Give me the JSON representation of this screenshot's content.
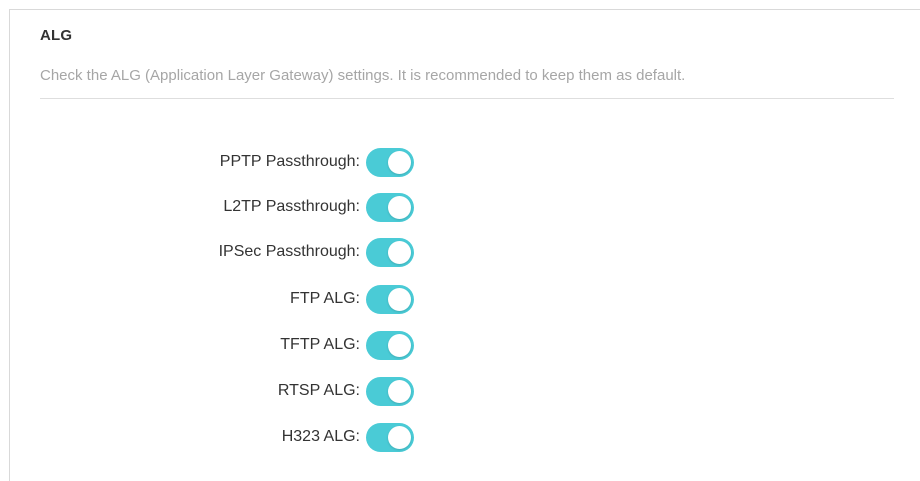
{
  "section": {
    "title": "ALG",
    "description": "Check the ALG (Application Layer Gateway) settings. It is recommended to keep them as default."
  },
  "colors": {
    "toggle_on": "#4acbd6",
    "toggle_off": "#cfcfcf",
    "label_text": "#333333",
    "description_text": "#a6a6a6"
  },
  "settings": [
    {
      "label": "PPTP Passthrough:",
      "enabled": true
    },
    {
      "label": "L2TP Passthrough:",
      "enabled": true
    },
    {
      "label": "IPSec Passthrough:",
      "enabled": true
    },
    {
      "label": "FTP ALG:",
      "enabled": true
    },
    {
      "label": "TFTP ALG:",
      "enabled": true
    },
    {
      "label": "RTSP ALG:",
      "enabled": true
    },
    {
      "label": "H323 ALG:",
      "enabled": true
    }
  ]
}
